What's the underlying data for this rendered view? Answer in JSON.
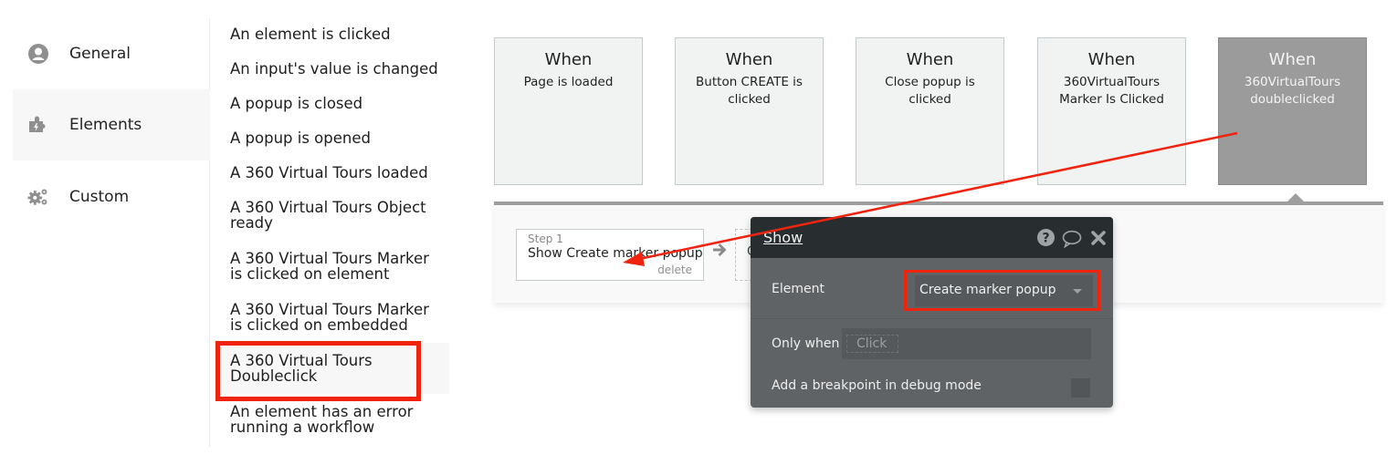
{
  "sidebar": {
    "items": [
      {
        "label": "General",
        "icon": "user-circle-icon",
        "active": false
      },
      {
        "label": "Elements",
        "icon": "puzzle-lightning-icon",
        "active": true
      },
      {
        "label": "Custom",
        "icon": "gears-icon",
        "active": false
      }
    ]
  },
  "events": {
    "items": [
      {
        "label": "An element is clicked"
      },
      {
        "label": "An input's value is changed"
      },
      {
        "label": "A popup is closed"
      },
      {
        "label": "A popup is opened"
      },
      {
        "label": "A 360 Virtual Tours loaded"
      },
      {
        "label_line1": "A 360 Virtual Tours Object",
        "label_line2": "ready"
      },
      {
        "label_line1": "A 360 Virtual Tours Marker",
        "label_line2": "is clicked on element"
      },
      {
        "label_line1": "A 360 Virtual Tours Marker",
        "label_line2": "is clicked on embedded"
      },
      {
        "label_line1": "A 360 Virtual Tours",
        "label_line2": "Doubleclick",
        "selected": true,
        "highlighted": true
      },
      {
        "label_line1": "An element has an error",
        "label_line2": "running a workflow"
      }
    ]
  },
  "workflow": {
    "cards": [
      {
        "when": "When",
        "line1": "Page is loaded",
        "line2": ""
      },
      {
        "when": "When",
        "line1": "Button CREATE is",
        "line2": "clicked"
      },
      {
        "when": "When",
        "line1": "Close popup is clicked",
        "line2": ""
      },
      {
        "when": "When",
        "line1": "360VirtualTours",
        "line2": "Marker Is Clicked"
      },
      {
        "when": "When",
        "line1": "360VirtualTours",
        "line2": "doubleclicked",
        "active": true
      }
    ],
    "step": {
      "number": "Step 1",
      "title": "Show Create marker popup",
      "delete_label": "delete"
    },
    "add_step_peek": "C"
  },
  "panel": {
    "title": "Show",
    "icons": [
      "help-icon",
      "comment-icon",
      "close-icon"
    ],
    "element_label": "Element",
    "element_value": "Create marker popup",
    "only_when_label": "Only when",
    "only_when_placeholder": "Click",
    "breakpoint_label": "Add a breakpoint in debug mode",
    "breakpoint_checked": false
  },
  "annotation": {
    "color": "#f0230f"
  }
}
